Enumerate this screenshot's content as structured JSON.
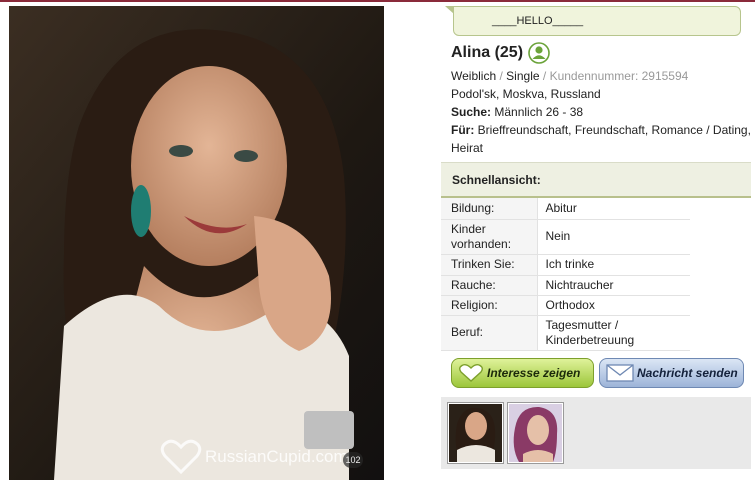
{
  "colors": {
    "accent_green": "#9cc63a",
    "accent_blue": "#9db4d8",
    "bubble_bg": "#f0f4dc",
    "brand_rule": "#8a2a3a"
  },
  "photo": {
    "watermark": "RussianCupid.com",
    "badge": "102"
  },
  "greeting": "____HELLO_____",
  "profile": {
    "name": "Alina (25)",
    "status_icon": "person-icon",
    "gender": "Weiblich",
    "separator": "/",
    "relationship": "Single",
    "member_id": "Kundennummer: 2915594",
    "location": "Podol'sk, Moskva, Russland",
    "seeking_label": "Suche:",
    "seeking_value": "Männlich 26 - 38",
    "for_label": "Für:",
    "for_value": "Brieffreundschaft, Freundschaft, Romance / Dating, Heirat"
  },
  "quick_view": {
    "title": "Schnellansicht:",
    "rows": [
      {
        "label": "Bildung:",
        "value": "Abitur"
      },
      {
        "label": "Kinder vorhanden:",
        "value": "Nein"
      },
      {
        "label": "Trinken Sie:",
        "value": "Ich trinke"
      },
      {
        "label": "Rauche:",
        "value": "Nichtraucher"
      },
      {
        "label": "Religion:",
        "value": "Orthodox"
      },
      {
        "label": "Beruf:",
        "value": "Tagesmutter / Kinderbetreuung"
      }
    ]
  },
  "actions": {
    "interest_label": "Interesse zeigen",
    "interest_icon": "heart-icon",
    "message_label": "Nachricht senden",
    "message_icon": "envelope-icon"
  },
  "thumbnails": [
    "thumbnail-1",
    "thumbnail-2"
  ]
}
